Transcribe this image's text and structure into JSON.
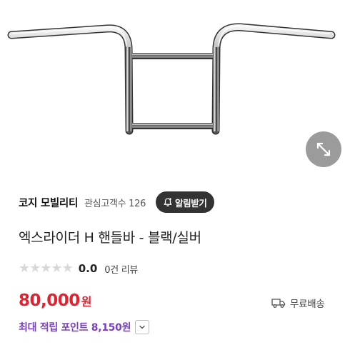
{
  "product_image": {
    "icon": "handlebar-image"
  },
  "zoom": {
    "icon": "expand-arrows-icon"
  },
  "store": {
    "name": "코지 모빌리티",
    "interest_label": "관심고객수 126",
    "alarm_label": "알림받기"
  },
  "product": {
    "title": "엑스라이더 H 핸들바 - 블랙/실버",
    "rating": "0.0",
    "review_count": "0건 리뷰",
    "stars_filled": 0,
    "stars_total": 5,
    "price": "80,000",
    "currency": "원",
    "shipping": "무료배송",
    "points": "최대 적립 포인트 8,150원"
  },
  "colors": {
    "price": "#e4212f",
    "points": "#7b3fc4",
    "alarm_bg": "#333333",
    "star_empty": "#d8d8d8"
  }
}
